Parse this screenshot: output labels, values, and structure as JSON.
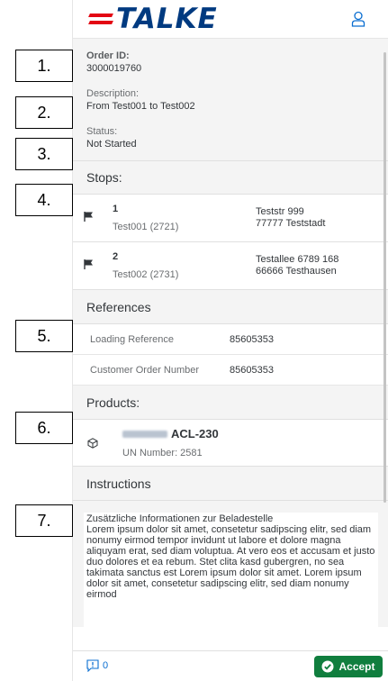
{
  "header": {
    "brand": "TALKE",
    "brand_color": "#003a80",
    "accent_color": "#e30613",
    "user_icon": "user-icon"
  },
  "order": {
    "id_label": "Order ID:",
    "id_value": "3000019760",
    "description_label": "Description:",
    "description_value": "From Test001 to Test002",
    "status_label": "Status:",
    "status_value": "Not Started"
  },
  "stops": {
    "title": "Stops:",
    "items": [
      {
        "number": "1",
        "name": "Test001 (2721)",
        "street": "Teststr 999",
        "city": "77777 Teststadt"
      },
      {
        "number": "2",
        "name": "Test002 (2731)",
        "street": "Testallee 6789 168",
        "city": "66666 Testhausen"
      }
    ]
  },
  "references": {
    "title": "References",
    "rows": [
      {
        "label": "Loading Reference",
        "value": "85605353"
      },
      {
        "label": "Customer Order Number",
        "value": "85605353"
      }
    ]
  },
  "products": {
    "title": "Products:",
    "items": [
      {
        "name": "ACL-230",
        "un": "UN Number: 2581"
      }
    ]
  },
  "instructions": {
    "title": "Instructions",
    "heading": "Zusätzliche Informationen zur Beladestelle",
    "text": "Lorem ipsum dolor sit amet, consetetur sadipscing elitr, sed diam nonumy eirmod tempor invidunt ut labore et dolore magna aliquyam erat, sed diam voluptua. At vero eos et accusam et justo duo dolores et ea rebum. Stet clita kasd gubergren, no sea takimata sanctus est Lorem ipsum dolor sit amet. Lorem ipsum dolor sit amet, consetetur sadipscing elitr, sed diam nonumy eirmod"
  },
  "footer": {
    "feedback_count": "0",
    "accept_label": "Accept",
    "accept_color": "#107e3e"
  },
  "annotations": [
    "1.",
    "2.",
    "3.",
    "4.",
    "5.",
    "6.",
    "7."
  ]
}
